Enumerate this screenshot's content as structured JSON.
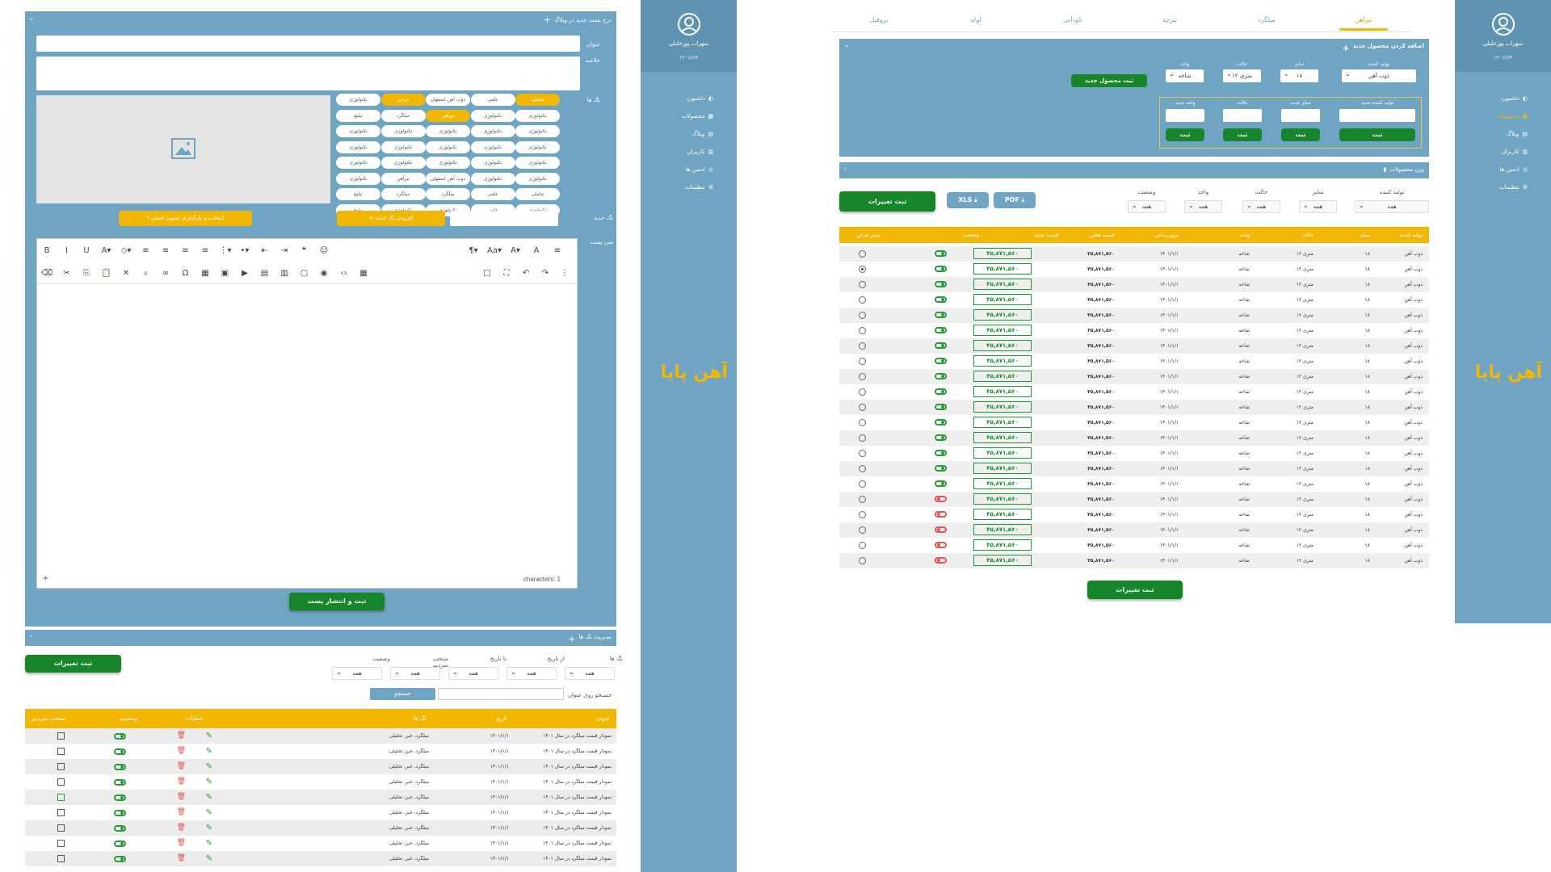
{
  "left": {
    "blog_header": "درج پست جدید در وبلاگ",
    "title_label": "عنوان",
    "summary_label": "خلاصه",
    "tags_label": "تگ ها",
    "new_tag_label": "تگ جدید",
    "body_label": "متن پست",
    "choose_image_btn": "انتخاب و بارگذاری تصویر اصلی",
    "add_tag_btn": "افزودن تگ جدید",
    "characters": "characters: 1",
    "publish_btn": "ثبت و انتشار پست",
    "tags": [
      "تحلیلی",
      "علمی",
      "ذوب آهن اصفهان",
      "درجی",
      "تکنولوژی",
      "تکنولوژی",
      "تکنولوژی",
      "تیرآهن",
      "میلگرد",
      "تبلیغ",
      "تکنولوژی",
      "تکنولوژی",
      "تکنولوژی",
      "تکنولوژی",
      "تکنولوژی",
      "تکنولوژی",
      "تکنولوژی",
      "تکنولوژی",
      "تکنولوژی",
      "تکنولوژی",
      "تکنولوژی",
      "تکنولوژی",
      "تکنولوژی",
      "تکنولوژی",
      "تکنولوژی",
      "تکنولوژی",
      "تکنولوژی",
      "ذوب آهن اصفهان",
      "تیرآهن",
      "تکنولوژی",
      "تحلیلی",
      "علمی",
      "میلگرد",
      "میلگرد",
      "تبلیغ",
      "تکنولوژی",
      "علمی",
      "تکنولوژی",
      "تکنولوژی",
      "تبلیغ"
    ],
    "tag_mgmt_header": "مدیریت تگ ها",
    "save_changes": "ثبت تغییرات",
    "filters": [
      {
        "label": "تگ ها",
        "value": "همه"
      },
      {
        "label": "از تاریخ",
        "value": "همه"
      },
      {
        "label": "تا تاریخ",
        "value": "همه"
      },
      {
        "label": "منتخب سردبیر",
        "value": "همه"
      },
      {
        "label": "وضعیت",
        "value": "همه"
      }
    ],
    "search_label": "جستجو روی عنوان",
    "search_btn": "جستجو",
    "table_headers": [
      "عنوان",
      "تاریخ",
      "تگ ها",
      "عملیات",
      "وضعیت",
      "منتخب سردبیر"
    ],
    "rows": [
      {
        "title": "نمودار قیمت میلگرد در سال ۱۴۰۱",
        "date": "۱۴۰۱/۱/۱",
        "tags": "میلگرد، خبر، تحلیلی",
        "checked": false
      },
      {
        "title": "نمودار قیمت میلگرد در سال ۱۴۰۱",
        "date": "۱۴۰۱/۱/۱",
        "tags": "میلگرد، خبر، تحلیلی",
        "checked": false
      },
      {
        "title": "نمودار قیمت میلگرد در سال ۱۴۰۱",
        "date": "۱۴۰۱/۱/۱",
        "tags": "میلگرد، خبر، تحلیلی",
        "checked": false
      },
      {
        "title": "نمودار قیمت میلگرد در سال ۱۴۰۱",
        "date": "۱۴۰۱/۱/۱",
        "tags": "میلگرد، خبر، تحلیلی",
        "checked": false
      },
      {
        "title": "نمودار قیمت میلگرد در سال ۱۴۰۱",
        "date": "۱۴۰۱/۱/۱",
        "tags": "میلگرد، خبر، تحلیلی",
        "checked": true
      },
      {
        "title": "نمودار قیمت میلگرد در سال ۱۴۰۱",
        "date": "۱۴۰۱/۱/۱",
        "tags": "میلگرد، خبر، تحلیلی",
        "checked": false
      },
      {
        "title": "نمودار قیمت میلگرد در سال ۱۴۰۱",
        "date": "۱۴۰۱/۱/۱",
        "tags": "میلگرد، خبر، تحلیلی",
        "checked": false
      },
      {
        "title": "نمودار قیمت میلگرد در سال ۱۴۰۱",
        "date": "۱۴۰۱/۱/۱",
        "tags": "میلگرد، خبر، تحلیلی",
        "checked": false
      },
      {
        "title": "نمودار قیمت میلگرد در سال ۱۴۰۱",
        "date": "۱۴۰۱/۱/۱",
        "tags": "میلگرد، خبر، تحلیلی",
        "checked": false
      }
    ]
  },
  "sidebar": {
    "user_name": "سهراب پورخلیلی",
    "user_date": "۱۴۰۱/۱/۳",
    "items": [
      "داشبورد",
      "محصولات",
      "وبلاگ",
      "کاربران",
      "ادمین ها",
      "تنظیمات"
    ],
    "logo_text": "آهن پایا"
  },
  "right": {
    "tabs": [
      "تیرآهن",
      "میلگرد",
      "تیرچه",
      "ناودانی",
      "لوله",
      "پروفیل"
    ],
    "add_header": "اضافه کردن محصول جدید",
    "add_fields": [
      {
        "label": "تولید کننده",
        "value": "ذوب آهن"
      },
      {
        "label": "سایز",
        "value": "۱۸"
      },
      {
        "label": "حالت",
        "value": "۱۲ متری"
      },
      {
        "label": "واحد",
        "value": "شاخه"
      }
    ],
    "add_product_btn": "ثبت محصول جدید",
    "new_fields": [
      "تولید کننده جدید",
      "سایز جدید",
      "حالت",
      "واحد جدید"
    ],
    "new_btn": "ثبت",
    "weight_header": "وزن محصولات",
    "filters": [
      {
        "label": "تولید کننده",
        "value": "همه"
      },
      {
        "label": "سایز",
        "value": "همه"
      },
      {
        "label": "حالت",
        "value": "همه"
      },
      {
        "label": "واحد",
        "value": "همه"
      },
      {
        "label": "وضعیت",
        "value": "همه"
      }
    ],
    "pdf_btn": "PDF",
    "xls_btn": "XLS",
    "save_changes": "ثبت تغییرات",
    "headers": [
      "تولید کننده",
      "سایز",
      "حالت",
      "واحد",
      "بروزرسانی",
      "قیمت فعلی",
      "قیمت جدید",
      "وضعیت",
      "پیش فرض"
    ],
    "row": {
      "maker": "ذوب آهن",
      "size": "۱۸",
      "state": "۱۲ متری",
      "unit": "شاخه",
      "update": "۱۴۰۱/۱/۱",
      "price": "۴۵,۸۷۱,۵۶۰",
      "new_price": "۴۵,۸۷۱,۵۶۰"
    },
    "row_status": [
      true,
      true,
      true,
      true,
      true,
      true,
      true,
      true,
      true,
      true,
      true,
      true,
      true,
      true,
      true,
      true,
      false,
      false,
      false,
      false,
      false
    ],
    "row_default": [
      false,
      true,
      false,
      false,
      false,
      false,
      false,
      false,
      false,
      false,
      false,
      false,
      false,
      false,
      false,
      false,
      false,
      false,
      false,
      false,
      false
    ],
    "bottom_save": "ثبت تغییرات"
  }
}
